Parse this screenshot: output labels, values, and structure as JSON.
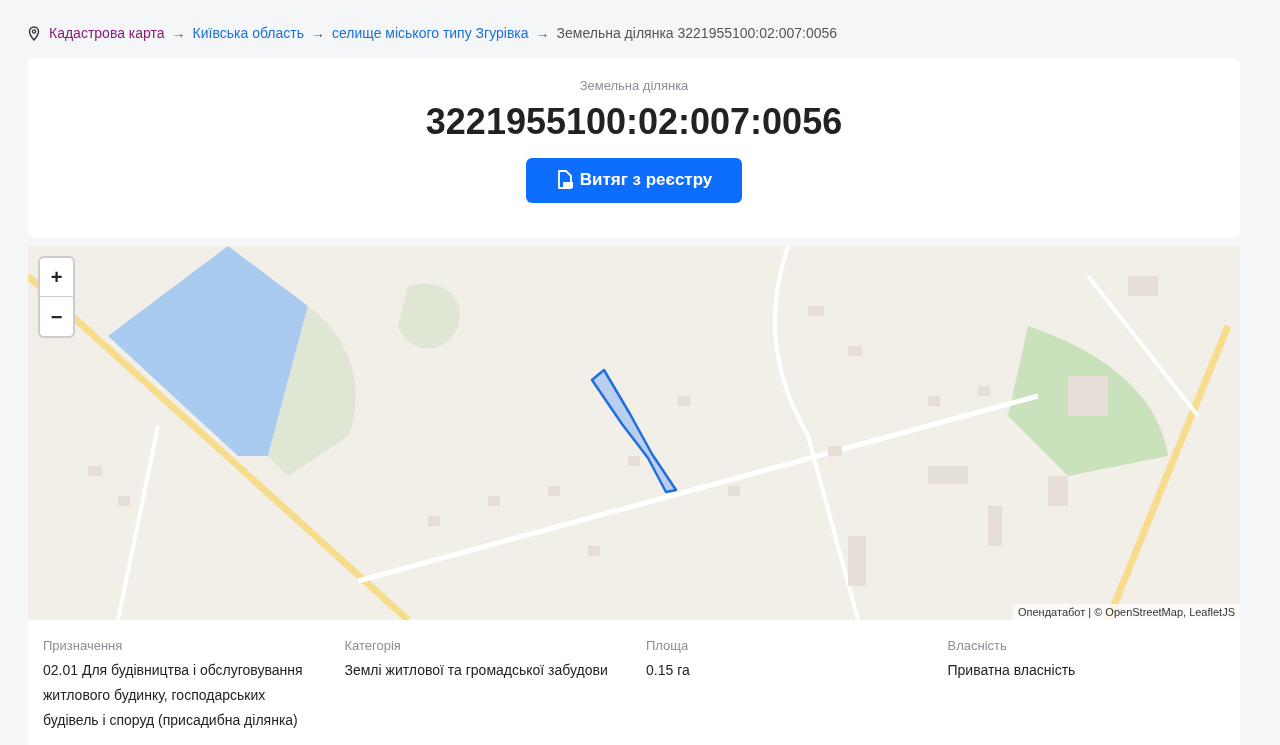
{
  "breadcrumb": [
    {
      "kind": "visited",
      "text": "Кадастрова карта"
    },
    {
      "kind": "separator",
      "text": "→"
    },
    {
      "kind": "link",
      "text": "Київська область"
    },
    {
      "kind": "separator",
      "text": "→"
    },
    {
      "kind": "link",
      "text": "селище міського типу Згурівка"
    },
    {
      "kind": "separator",
      "text": "→"
    },
    {
      "kind": "current",
      "text": "Земельна ділянка 3221955100:02:007:0056"
    }
  ],
  "header": {
    "subtitle": "Земельна ділянка",
    "title": "3221955100:02:007:0056",
    "button": "Витяг з реєстру"
  },
  "map": {
    "zoom_in": "+",
    "zoom_out": "−",
    "attribution": "Опендатабот | © OpenStreetMap, LeafletJS"
  },
  "details": [
    {
      "label": "Призначення",
      "value": "02.01 Для будівництва і обслуговування житлового будинку, господарських будівель і споруд (присадибна ділянка)"
    },
    {
      "label": "Категорія",
      "value": "Землі житлової та громадської забудови"
    },
    {
      "label": "Площа",
      "value": "0.15 га"
    },
    {
      "label": "Власність",
      "value": "Приватна власність"
    }
  ]
}
